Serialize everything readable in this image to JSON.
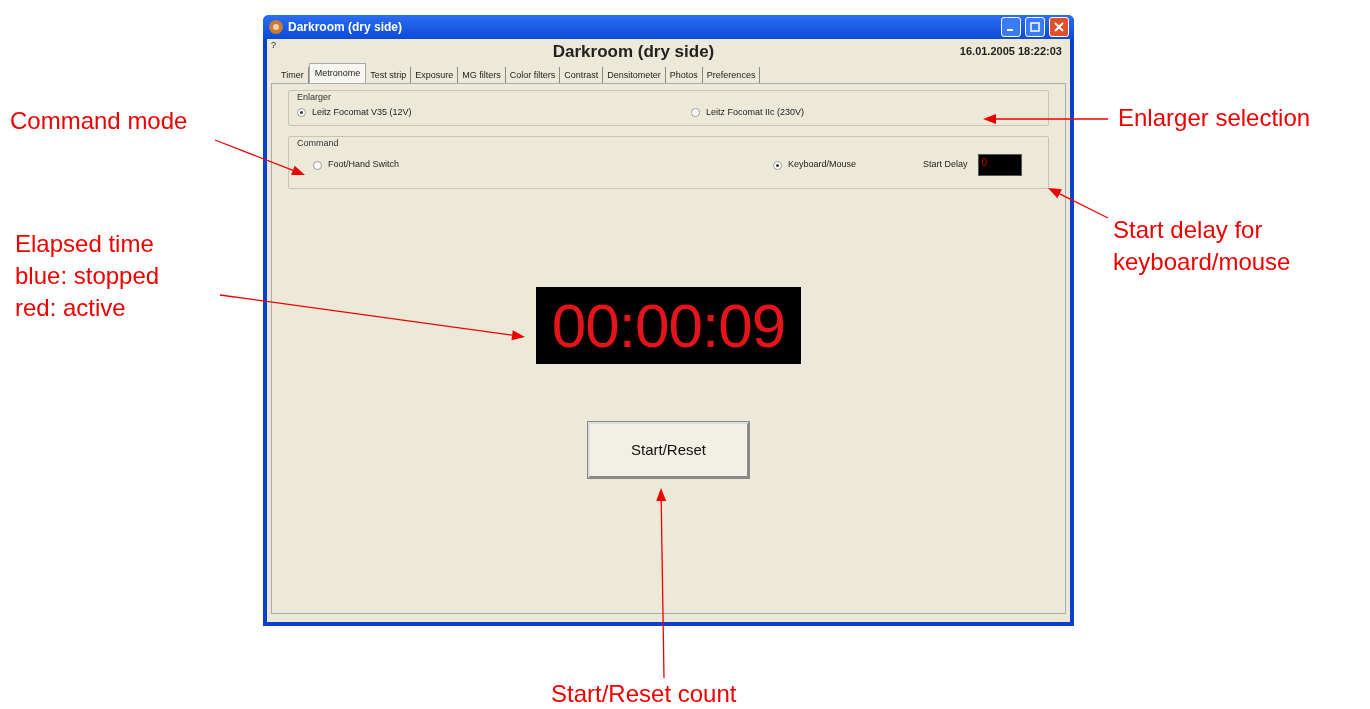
{
  "window": {
    "title": "Darkroom (dry side)"
  },
  "header": {
    "help": "?",
    "heading": "Darkroom (dry side)",
    "datetime": "16.01.2005 18:22:03"
  },
  "tabs": [
    {
      "label": "Timer",
      "selected": false
    },
    {
      "label": "Metronome",
      "selected": true
    },
    {
      "label": "Test strip",
      "selected": false
    },
    {
      "label": "Exposure",
      "selected": false
    },
    {
      "label": "MG filters",
      "selected": false
    },
    {
      "label": "Color filters",
      "selected": false
    },
    {
      "label": "Contrast",
      "selected": false
    },
    {
      "label": "Densitometer",
      "selected": false
    },
    {
      "label": "Photos",
      "selected": false
    },
    {
      "label": "Preferences",
      "selected": false
    }
  ],
  "enlarger": {
    "label": "Enlarger",
    "options": [
      {
        "label": "Leitz Focomat V35 (12V)",
        "selected": true
      },
      {
        "label": "Leitz Focomat IIc (230V)",
        "selected": false
      }
    ]
  },
  "command": {
    "label": "Command",
    "options": [
      {
        "label": "Foot/Hand Switch",
        "selected": false
      },
      {
        "label": "Keyboard/Mouse",
        "selected": true
      }
    ],
    "start_delay_label": "Start Delay",
    "start_delay_value": "0"
  },
  "timer": {
    "value": "00:00:09",
    "running": true
  },
  "button": {
    "label": "Start/Reset"
  },
  "annotations": [
    {
      "lines": [
        "Command mode"
      ]
    },
    {
      "lines": [
        "Enlarger selection"
      ]
    },
    {
      "lines": [
        "Elapsed time",
        "blue: stopped",
        "red: active"
      ]
    },
    {
      "lines": [
        "Start delay for",
        "keyboard/mouse"
      ]
    },
    {
      "lines": [
        "Start/Reset count"
      ]
    }
  ]
}
